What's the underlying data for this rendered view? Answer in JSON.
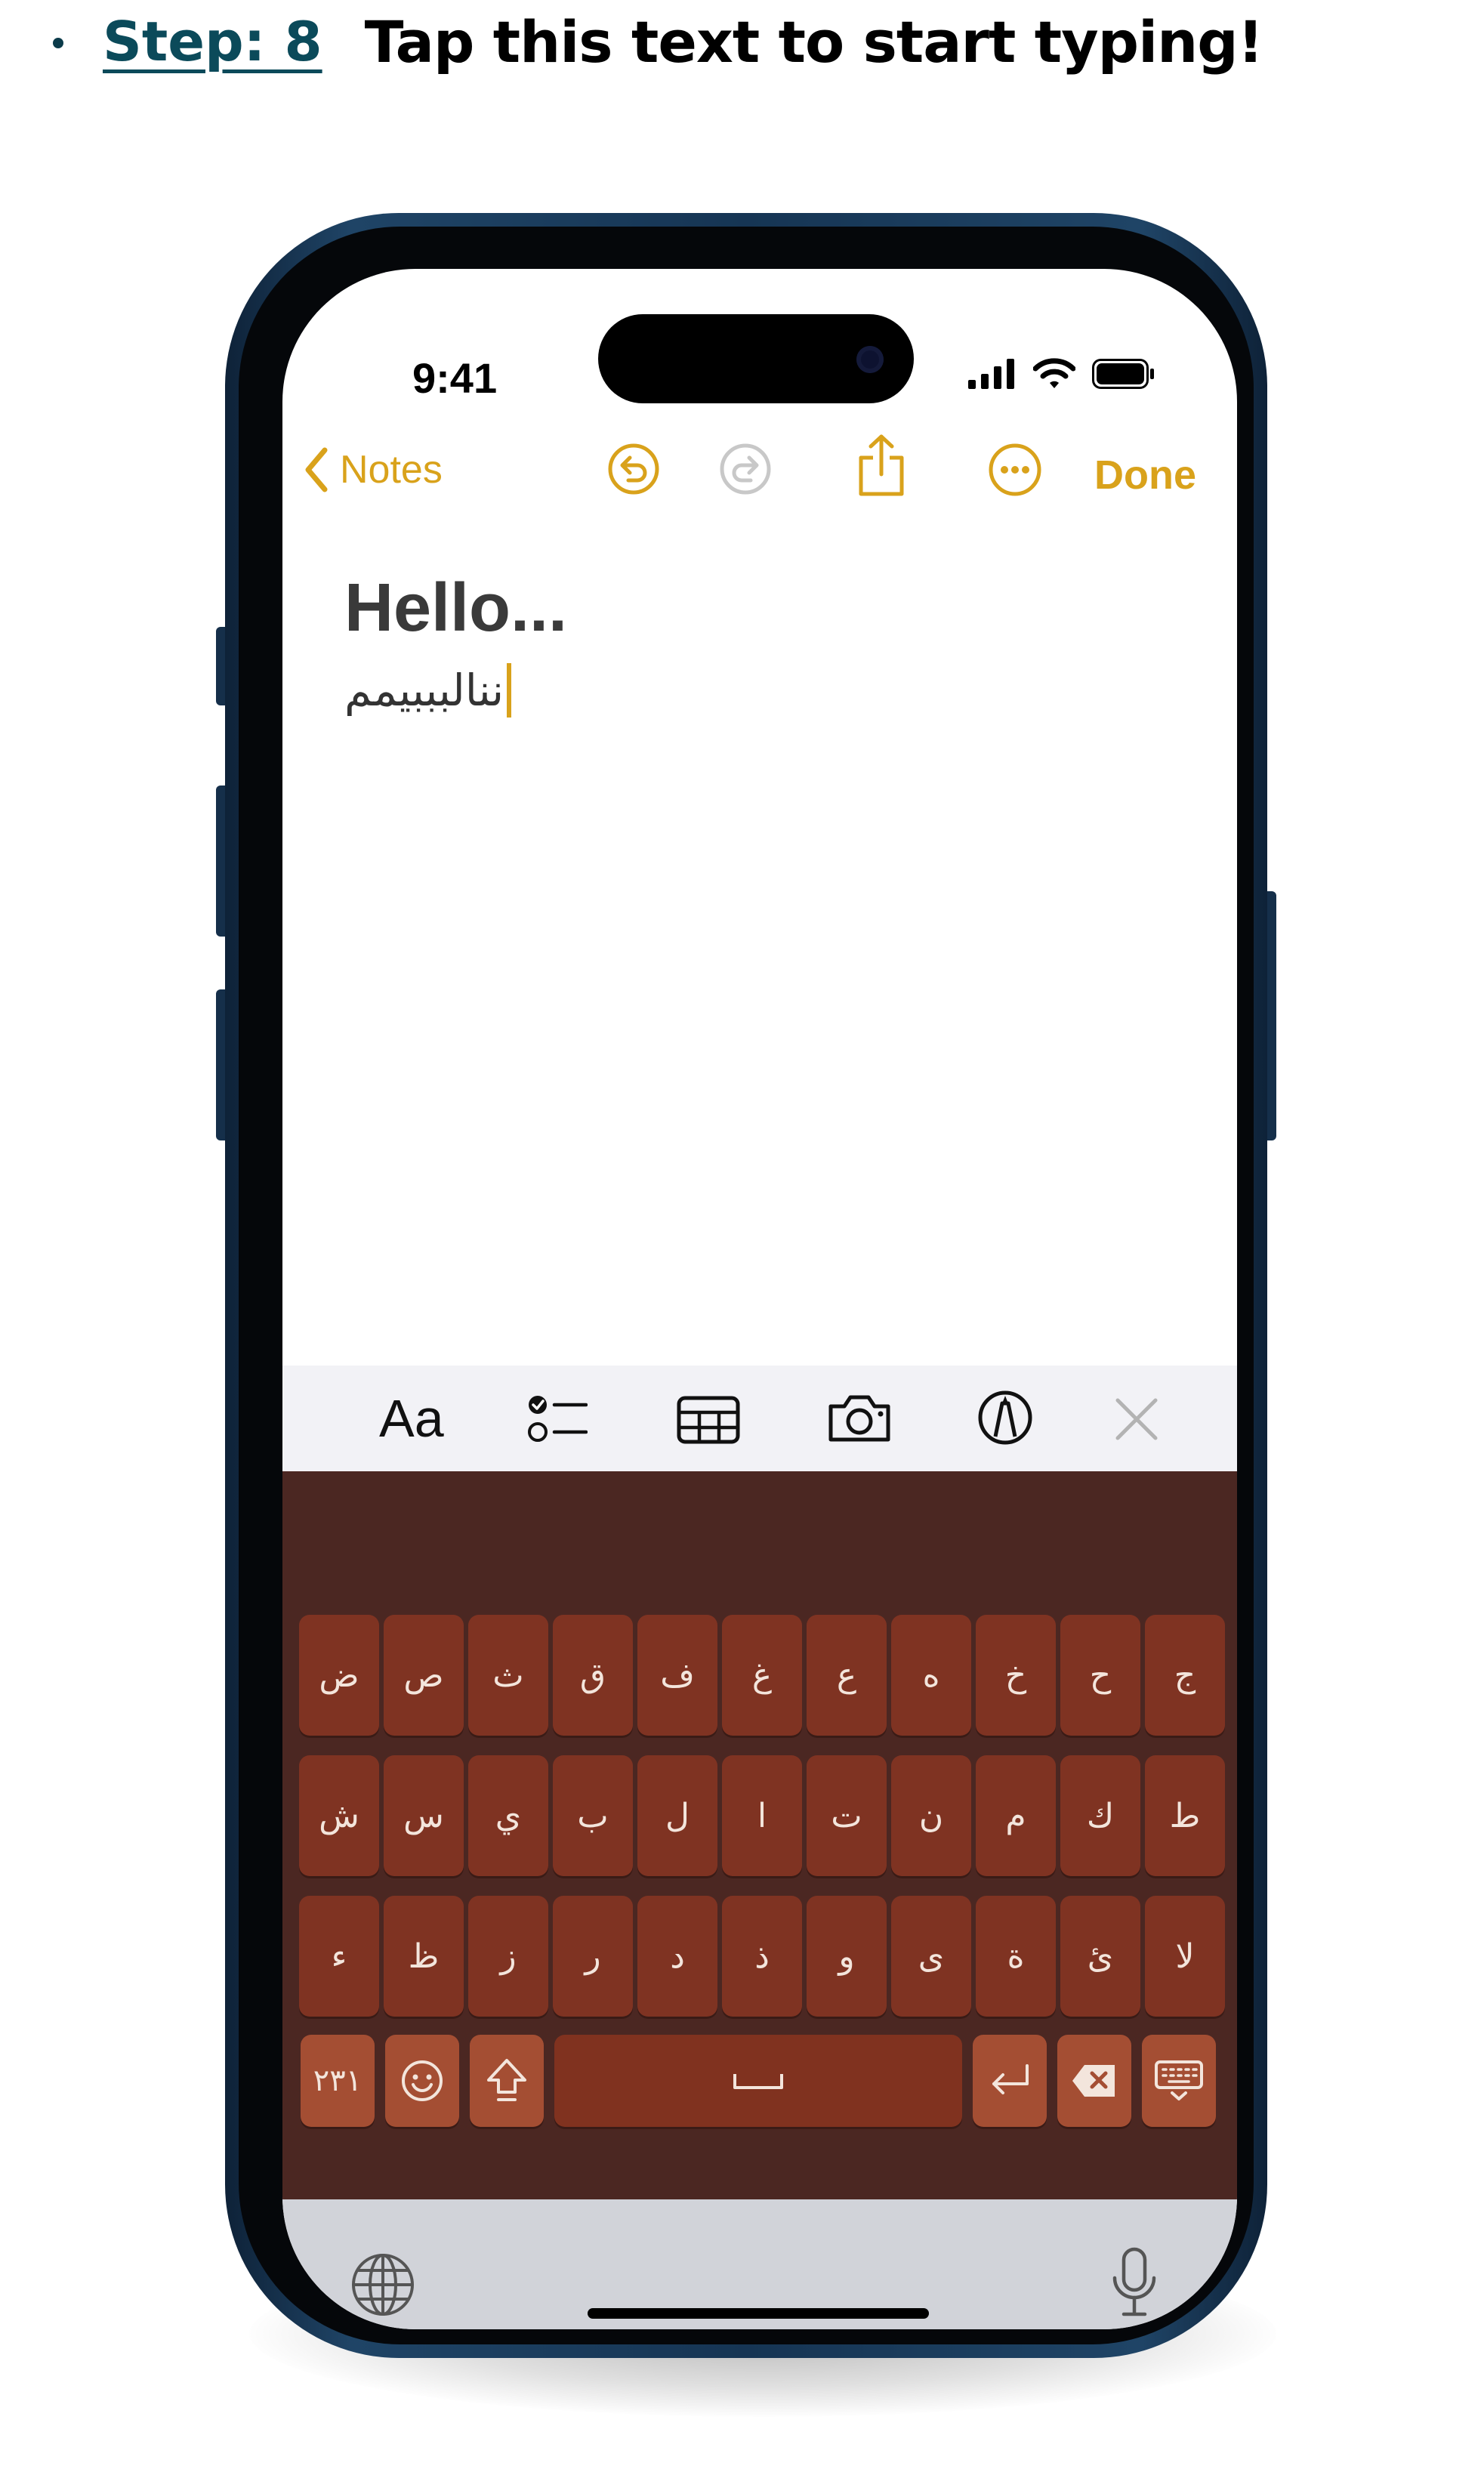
{
  "step": {
    "label": "Step: 8",
    "instruction": "Tap this text to start typing!"
  },
  "status_bar": {
    "time": "9:41",
    "icons": [
      "signal-icon",
      "wifi-icon",
      "battery-icon"
    ]
  },
  "nav": {
    "back_label": "Notes",
    "done_label": "Done",
    "accent_color": "#d9a21b",
    "icons": [
      "chevron-left-icon",
      "undo-icon",
      "redo-icon",
      "share-icon",
      "more-icon"
    ]
  },
  "note": {
    "title": "Hello...",
    "body": "ننالبببيمم"
  },
  "toolbar": {
    "format_label": "Aa",
    "icons": [
      "checklist-icon",
      "table-icon",
      "camera-icon",
      "markup-icon",
      "close-icon"
    ]
  },
  "keyboard": {
    "background_color": "#4b2722",
    "key_color": "#7f3322",
    "rows": [
      [
        "ض",
        "ص",
        "ث",
        "ق",
        "ف",
        "غ",
        "ع",
        "ه",
        "خ",
        "ح",
        "ج"
      ],
      [
        "ش",
        "س",
        "ي",
        "ب",
        "ل",
        "ا",
        "ت",
        "ن",
        "م",
        "ك",
        "ط"
      ],
      [
        "ء",
        "ظ",
        "ز",
        "ر",
        "د",
        "ذ",
        "و",
        "ى",
        "ة",
        "ئ",
        "لا"
      ]
    ],
    "numbers_label": "٢٣١",
    "bottom_icons": [
      "emoji-icon",
      "shift-icon",
      "space-icon",
      "return-icon",
      "delete-icon",
      "keyboard-dismiss-icon"
    ]
  },
  "bottom_bar": {
    "icons": [
      "globe-icon",
      "microphone-icon"
    ]
  }
}
